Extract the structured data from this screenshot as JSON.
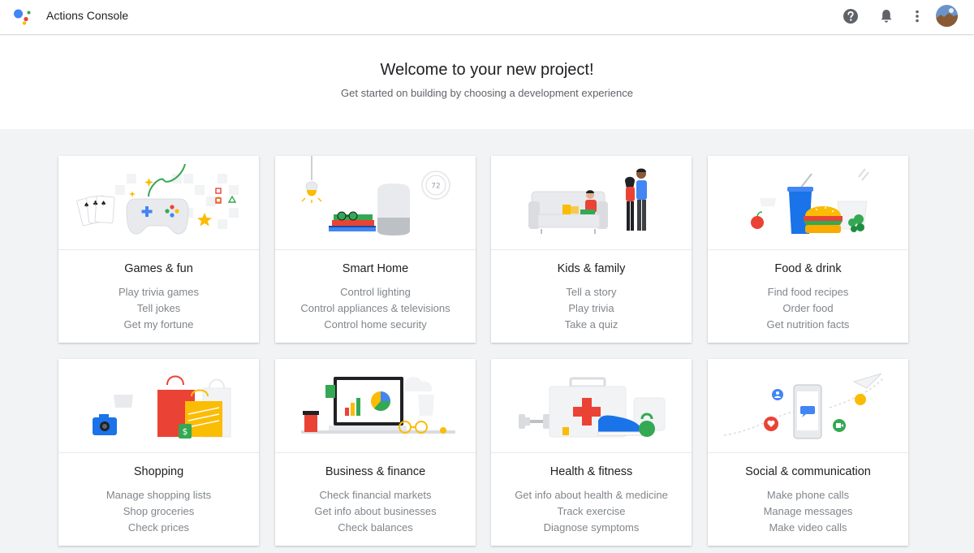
{
  "app": {
    "title": "Actions Console"
  },
  "header": {
    "icons": [
      "help-icon",
      "notifications-icon",
      "more-vert-icon"
    ]
  },
  "welcome": {
    "title": "Welcome to your new project!",
    "subtitle": "Get started on building by choosing a development experience"
  },
  "colors": {
    "blue": "#4285f4",
    "red": "#ea4335",
    "yellow": "#fbbc04",
    "green": "#34a853",
    "background": "#f1f3f4"
  },
  "categories": [
    {
      "title": "Games & fun",
      "examples": [
        "Play trivia games",
        "Tell jokes",
        "Get my fortune"
      ]
    },
    {
      "title": "Smart Home",
      "examples": [
        "Control lighting",
        "Control appliances & televisions",
        "Control home security"
      ],
      "thermostat_reading": "72"
    },
    {
      "title": "Kids & family",
      "examples": [
        "Tell a story",
        "Play trivia",
        "Take a quiz"
      ]
    },
    {
      "title": "Food & drink",
      "examples": [
        "Find food recipes",
        "Order food",
        "Get nutrition facts"
      ]
    },
    {
      "title": "Shopping",
      "examples": [
        "Manage shopping lists",
        "Shop groceries",
        "Check prices"
      ]
    },
    {
      "title": "Business & finance",
      "examples": [
        "Check financial markets",
        "Get info about businesses",
        "Check balances"
      ]
    },
    {
      "title": "Health & fitness",
      "examples": [
        "Get info about health & medicine",
        "Track exercise",
        "Diagnose symptoms"
      ]
    },
    {
      "title": "Social & communication",
      "examples": [
        "Make phone calls",
        "Manage messages",
        "Make video calls"
      ]
    }
  ]
}
